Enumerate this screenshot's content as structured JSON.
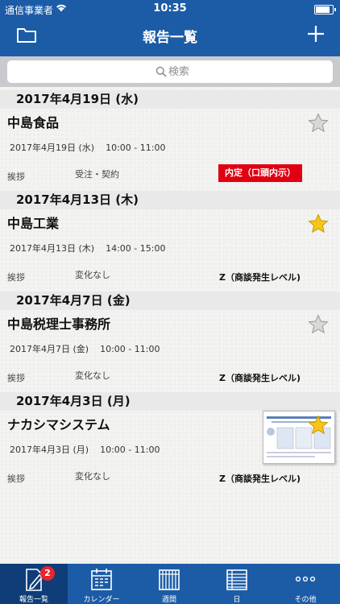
{
  "status_bar": {
    "carrier": "通信事業者",
    "time": "10:35",
    "battery_level": 0.95
  },
  "nav": {
    "title": "報告一覧",
    "left_icon": "folder-icon",
    "right_icon": "plus-icon"
  },
  "search": {
    "placeholder": "検索"
  },
  "reports": [
    {
      "date": "2017年4月19日 (水)",
      "company": "中島食品",
      "starred": false,
      "visit_date": "2017年4月19日 (水)",
      "time_range": "10:00 - 11:00",
      "category": "挨拶",
      "progress": "受注・契約",
      "status": "内定（口頭内示）",
      "status_color": "#e00012"
    },
    {
      "date": "2017年4月13日 (木)",
      "company": "中島工業",
      "starred": true,
      "visit_date": "2017年4月13日 (木)",
      "time_range": "14:00 - 15:00",
      "category": "挨拶",
      "progress": "変化なし",
      "status": "Z（商談発生レベル)"
    },
    {
      "date": "2017年4月7日 (金)",
      "company": "中島税理士事務所",
      "starred": false,
      "visit_date": "2017年4月7日 (金)",
      "time_range": "10:00 - 11:00",
      "category": "挨拶",
      "progress": "変化なし",
      "status": "Z（商談発生レベル)"
    },
    {
      "date": "2017年4月3日 (月)",
      "company": "ナカシマシステム",
      "starred": true,
      "visit_date": "2017年4月3日 (月)",
      "time_range": "10:00 - 11:00",
      "category": "挨拶",
      "progress": "変化なし",
      "status": "Z（商談発生レベル)",
      "has_attachment": true
    }
  ],
  "tabbar": {
    "items": [
      {
        "label": "報告一覧",
        "icon": "edit-report-icon",
        "badge": "2",
        "active": true
      },
      {
        "label": "カレンダー",
        "icon": "calendar-icon"
      },
      {
        "label": "週間",
        "icon": "week-icon"
      },
      {
        "label": "日",
        "icon": "day-list-icon"
      },
      {
        "label": "その他",
        "icon": "more-icon"
      }
    ]
  },
  "colors": {
    "brand": "#1c5ca7",
    "tab_active": "#0e3d78",
    "star_on": "#f7c51a",
    "star_off": "#d8d8d8"
  }
}
